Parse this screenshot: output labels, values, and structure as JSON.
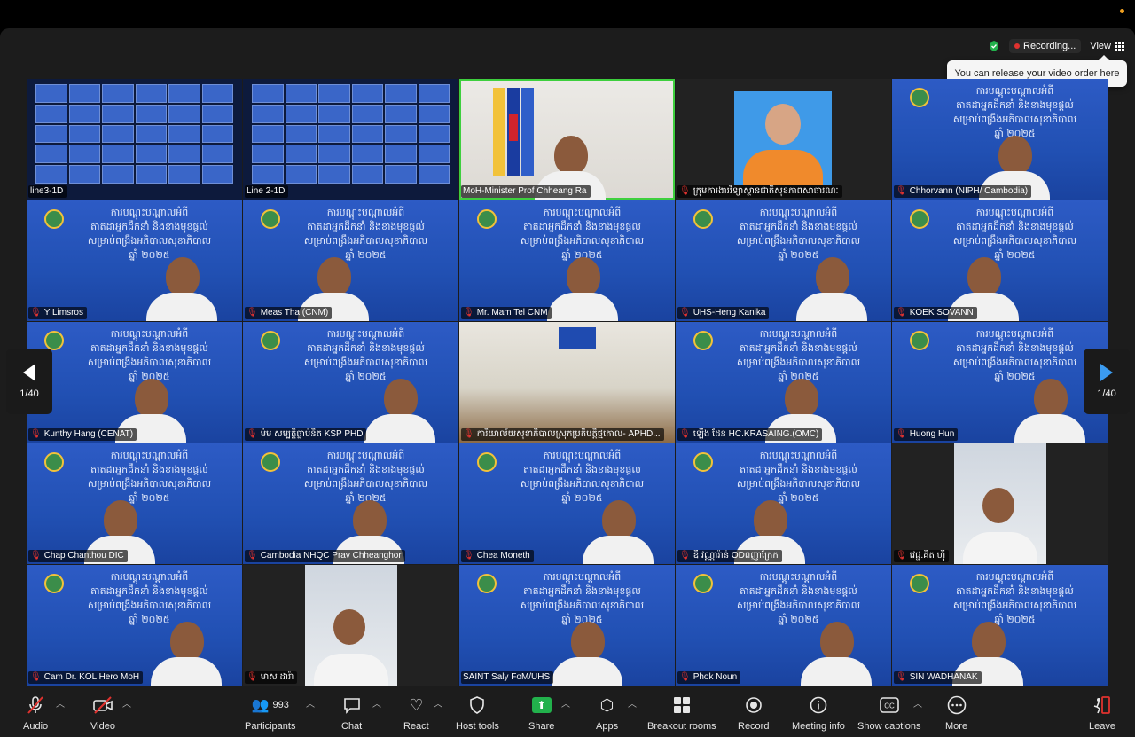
{
  "top": {
    "recording": "Recording...",
    "view": "View",
    "tooltip": "You can release your video order here"
  },
  "banner_lines": [
    "ការបណ្តុះបណ្តាលអំពី",
    "តាតដាអ្នកដឹកនាំ និងខាងមុខផ្តល់",
    "សម្រាប់ពង្រឹងអភិបាលសុខាភិបាល",
    "ឆ្នាំ ២០២៥"
  ],
  "tiles": [
    {
      "name": "line3-1D",
      "muted": false,
      "kind": "gallery"
    },
    {
      "name": "Line 2-1D",
      "muted": false,
      "kind": "gallery"
    },
    {
      "name": "MoH-Minister Prof Chheang Ra",
      "muted": false,
      "kind": "minister"
    },
    {
      "name": "ក្រុមការងារវិទ្យាស្ថានជាតិសុខភាពសាធារណៈ",
      "muted": true,
      "kind": "portrait"
    },
    {
      "name": "Chhorvann (NIPH/ Cambodia)",
      "muted": true,
      "kind": "blue"
    },
    {
      "name": "Y Limsros",
      "muted": true,
      "kind": "blue"
    },
    {
      "name": "Meas Tha (CNM)",
      "muted": true,
      "kind": "blue"
    },
    {
      "name": "Mr. Mam Tel CNM",
      "muted": true,
      "kind": "blue"
    },
    {
      "name": "UHS-Heng Kanika",
      "muted": true,
      "kind": "blue"
    },
    {
      "name": "KOEK SOVANN",
      "muted": true,
      "kind": "blue"
    },
    {
      "name": "Kunthy Hang (CENAT)",
      "muted": true,
      "kind": "blue"
    },
    {
      "name": "ម៉ម សម្បត្តិធ្លាប់និត KSP PHD",
      "muted": true,
      "kind": "blue"
    },
    {
      "name": "ការិយាល័យសុខាភិបាលស្រុកប្រតិបត្តិថ្មគោល- APHD...",
      "muted": true,
      "kind": "room"
    },
    {
      "name": "ឡើង ដែន HC.KRASAING.(OMC)",
      "muted": true,
      "kind": "blue"
    },
    {
      "name": "Huong Hun",
      "muted": true,
      "kind": "blue"
    },
    {
      "name": "Chap Chanthou DIC",
      "muted": true,
      "kind": "blue"
    },
    {
      "name": "Cambodia NHQC Prav Chheanghor",
      "muted": true,
      "kind": "blue"
    },
    {
      "name": "Chea Moneth",
      "muted": true,
      "kind": "blue"
    },
    {
      "name": "ឌី វណ្ណារ៉ាន់ ODពញាក្រែក",
      "muted": true,
      "kind": "blue"
    },
    {
      "name": "វេជ្ជ.គិត ហ៊ី",
      "muted": true,
      "kind": "dark"
    },
    {
      "name": "Cam Dr. KOL Hero MoH",
      "muted": true,
      "kind": "blue"
    },
    {
      "name": "មាស ដារ៉ា",
      "muted": true,
      "kind": "dark"
    },
    {
      "name": "SAINT Saly FoM/UHS",
      "muted": false,
      "kind": "blue"
    },
    {
      "name": "Phok Noun",
      "muted": true,
      "kind": "blue"
    },
    {
      "name": "SIN WADHANAK",
      "muted": true,
      "kind": "blue"
    }
  ],
  "pager": {
    "left": "1/40",
    "right": "1/40"
  },
  "toolbar": {
    "audio": "Audio",
    "video": "Video",
    "participants": "Participants",
    "participants_count": "993",
    "chat": "Chat",
    "react": "React",
    "host_tools": "Host tools",
    "share": "Share",
    "apps": "Apps",
    "breakout": "Breakout rooms",
    "record": "Record",
    "meeting_info": "Meeting info",
    "captions": "Show captions",
    "more": "More",
    "leave": "Leave"
  },
  "colors": {
    "tile_blue": "#2150b3",
    "speaker_outline": "#3ecf3e",
    "share_green": "#22b14c",
    "leave_red": "#e0322f"
  }
}
